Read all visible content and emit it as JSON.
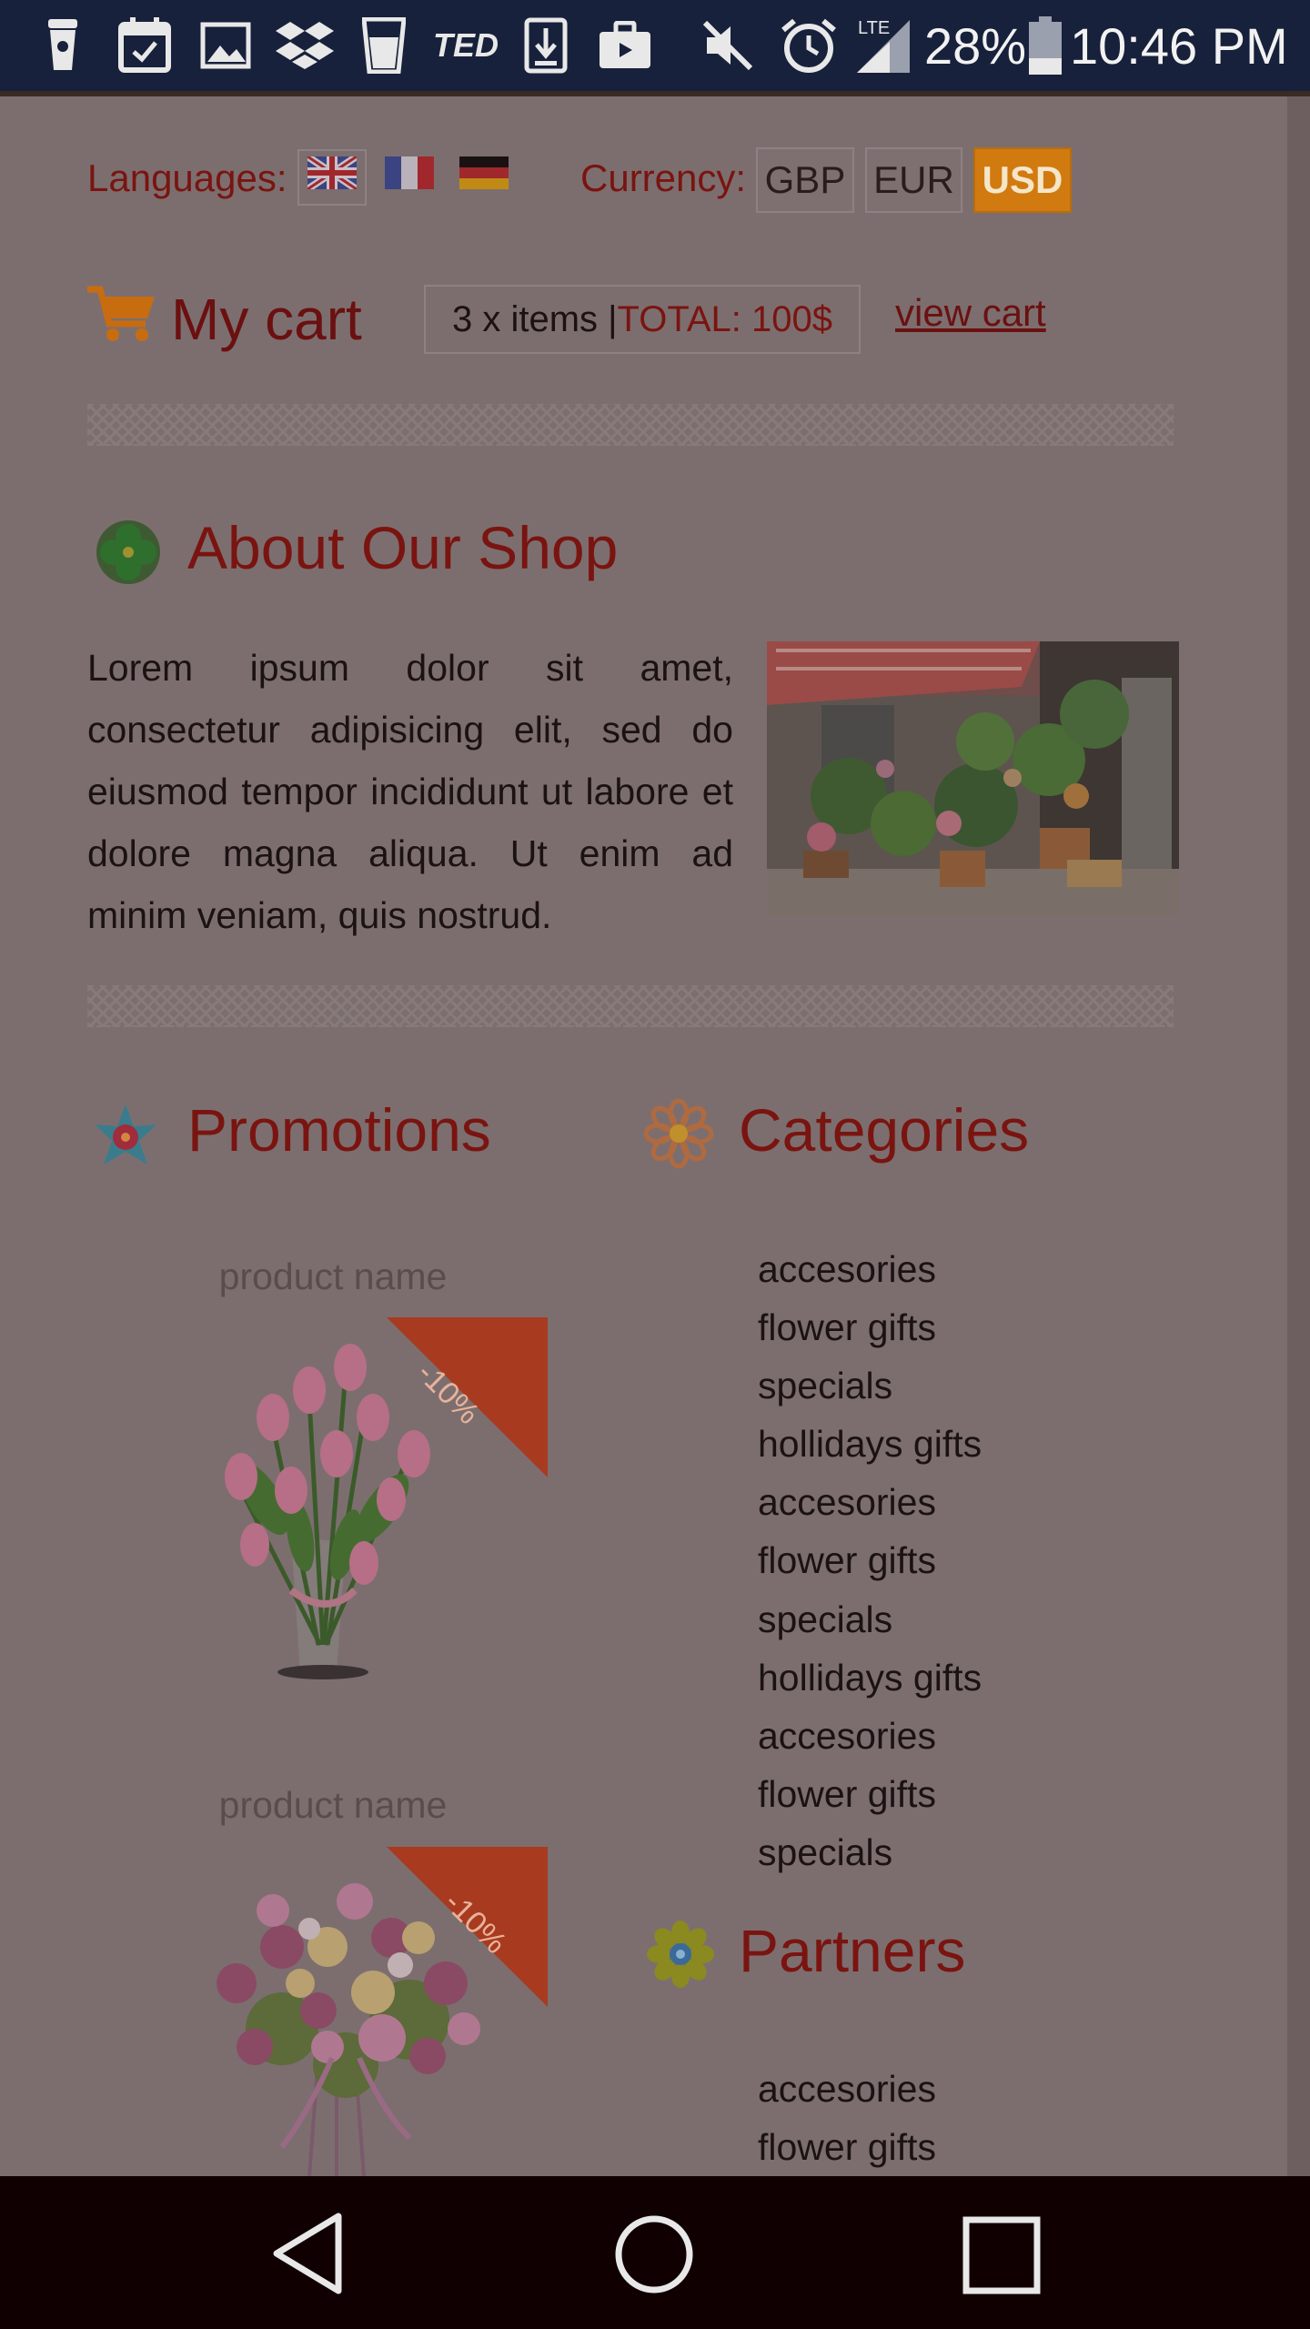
{
  "status_bar": {
    "battery_percent": "28%",
    "time": "10:46 PM",
    "network": "LTE",
    "icons": [
      "coffee-cup-icon",
      "calendar-icon",
      "gallery-icon",
      "dropbox-icon",
      "glass-icon",
      "ted-icon",
      "download-icon",
      "briefcase-icon",
      "mute-icon",
      "alarm-icon",
      "signal-icon",
      "battery-icon"
    ],
    "ted_label": "TED"
  },
  "top_bar": {
    "languages_label": "Languages:",
    "currency_label": "Currency:",
    "currencies": [
      "GBP",
      "EUR",
      "USD"
    ],
    "active_currency": "USD"
  },
  "cart": {
    "title": "My cart",
    "items_text": "3 x items | ",
    "total_text": "TOTAL: 100$",
    "view_cart_label": "view cart"
  },
  "about": {
    "title": "About Our Shop",
    "text": "Lorem ipsum dolor sit amet, consectetur adipisicing elit, sed do eiusmod tempor incididunt ut labore et dolore magna aliqua. Ut enim ad minim veniam, quis nostrud."
  },
  "promotions": {
    "title": "Promotions",
    "products": [
      {
        "name": "product name",
        "badge": "-10%"
      },
      {
        "name": "product name",
        "badge": "-10%"
      }
    ]
  },
  "categories": {
    "title": "Categories",
    "items": [
      "accesories",
      "flower gifts",
      "specials",
      "hollidays gifts",
      "accesories",
      "flower gifts",
      "specials",
      "hollidays gifts",
      "accesories",
      "flower gifts",
      "specials"
    ]
  },
  "partners": {
    "title": "Partners",
    "items": [
      "accesories",
      "flower gifts"
    ]
  },
  "colors": {
    "accent_red": "#7a1410",
    "currency_active": "#d17a10",
    "overlay_bg": "#7c6e6f",
    "status_bar": "#17213b"
  }
}
